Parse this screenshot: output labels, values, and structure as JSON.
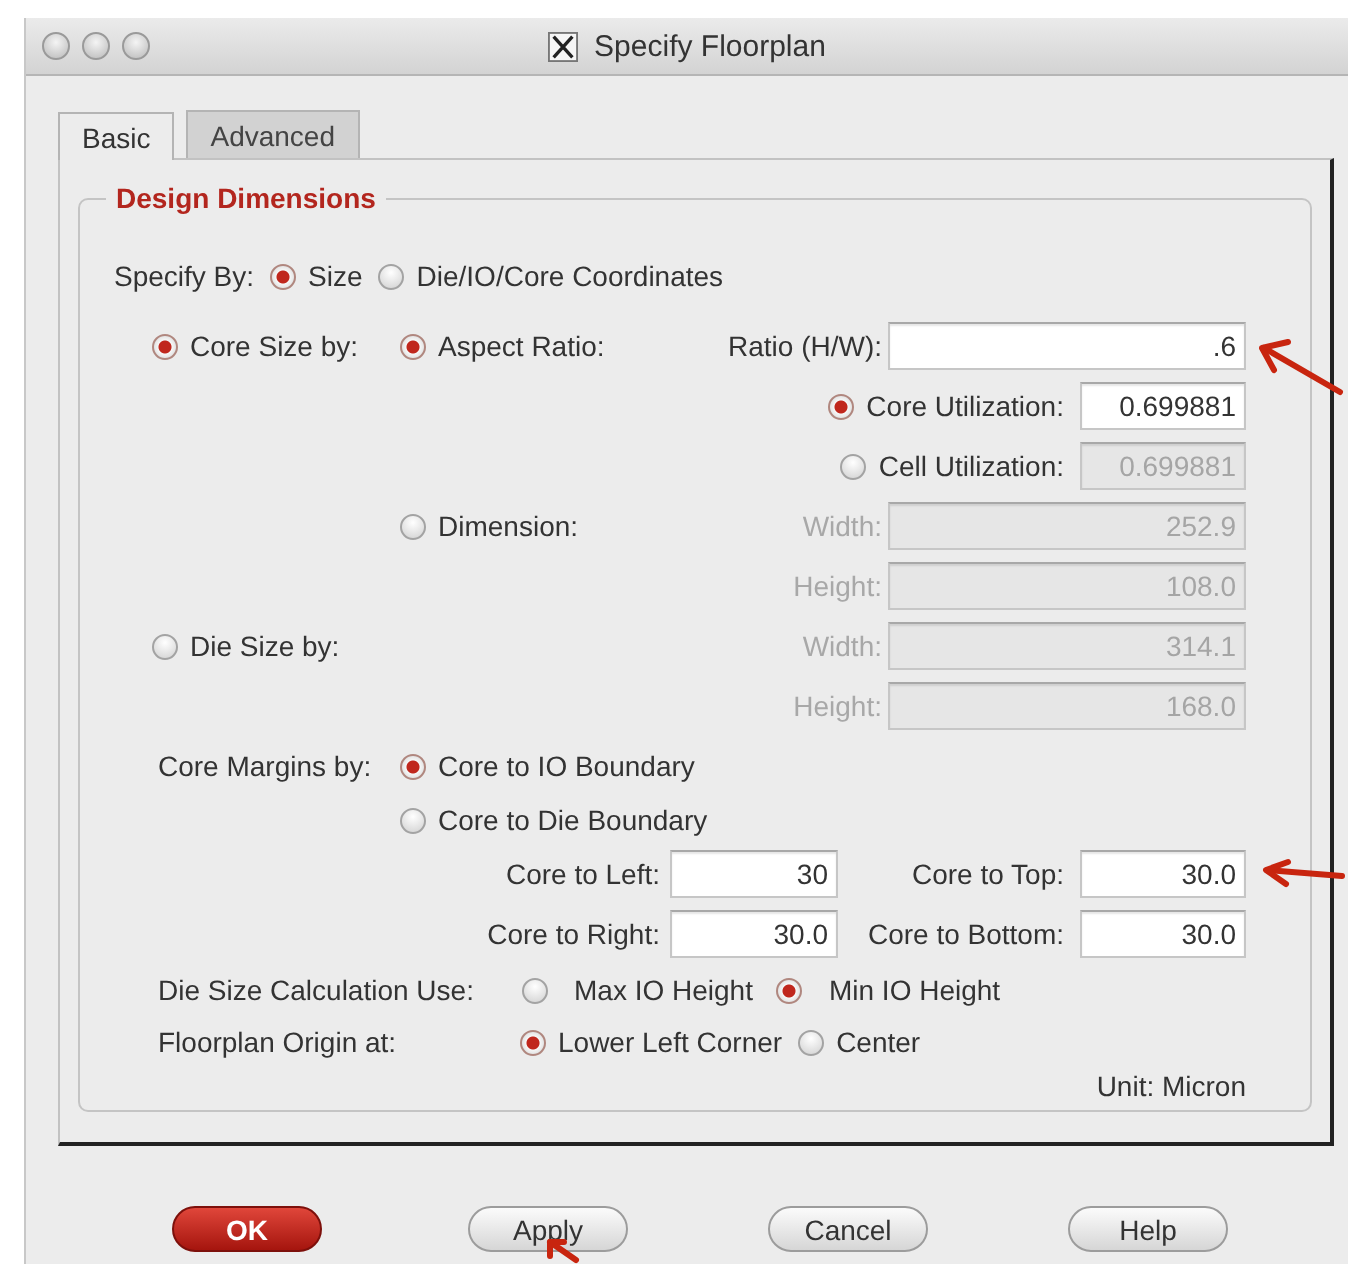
{
  "window": {
    "title": "Specify Floorplan"
  },
  "tabs": [
    {
      "label": "Basic",
      "selected": true
    },
    {
      "label": "Advanced",
      "selected": false
    }
  ],
  "group": {
    "title": "Design Dimensions"
  },
  "specify_by": {
    "label": "Specify By:",
    "options": [
      {
        "label": "Size",
        "selected": true
      },
      {
        "label": "Die/IO/Core Coordinates",
        "selected": false
      }
    ]
  },
  "core_size": {
    "label": "Core Size by:",
    "selected": true,
    "aspect_ratio": {
      "label": "Aspect Ratio:",
      "selected": true,
      "field": {
        "label": "Ratio (H/W):",
        "value": ".6",
        "disabled": false
      }
    },
    "utilization": [
      {
        "label": "Core Utilization:",
        "selected": true,
        "value": "0.699881",
        "disabled": false
      },
      {
        "label": "Cell Utilization:",
        "selected": false,
        "value": "0.699881",
        "disabled": true
      }
    ],
    "dimension": {
      "label": "Dimension:",
      "selected": false,
      "fields": [
        {
          "label": "Width:",
          "value": "252.9",
          "disabled": true
        },
        {
          "label": "Height:",
          "value": "108.0",
          "disabled": true
        }
      ]
    }
  },
  "die_size": {
    "label": "Die Size by:",
    "selected": false,
    "fields": [
      {
        "label": "Width:",
        "value": "314.1",
        "disabled": true
      },
      {
        "label": "Height:",
        "value": "168.0",
        "disabled": true
      }
    ]
  },
  "core_margins": {
    "label": "Core Margins by:",
    "options": [
      {
        "label": "Core to IO Boundary",
        "selected": true
      },
      {
        "label": "Core to Die Boundary",
        "selected": false
      }
    ],
    "fields": [
      {
        "label": "Core to Left:",
        "value": "30",
        "disabled": false
      },
      {
        "label": "Core to Top:",
        "value": "30.0",
        "disabled": false
      },
      {
        "label": "Core to Right:",
        "value": "30.0",
        "disabled": false
      },
      {
        "label": "Core to Bottom:",
        "value": "30.0",
        "disabled": false
      }
    ]
  },
  "die_size_calculation": {
    "label": "Die Size Calculation Use:",
    "options": [
      {
        "label": "Max IO Height",
        "selected": false
      },
      {
        "label": "Min IO Height",
        "selected": true
      }
    ]
  },
  "floorplan_origin": {
    "label": "Floorplan Origin at:",
    "options": [
      {
        "label": "Lower Left Corner",
        "selected": true
      },
      {
        "label": "Center",
        "selected": false
      }
    ]
  },
  "unit": "Unit: Micron",
  "buttons": [
    {
      "label": "OK",
      "kind": "default"
    },
    {
      "label": "Apply",
      "kind": "normal"
    },
    {
      "label": "Cancel",
      "kind": "normal"
    },
    {
      "label": "Help",
      "kind": "normal"
    }
  ]
}
